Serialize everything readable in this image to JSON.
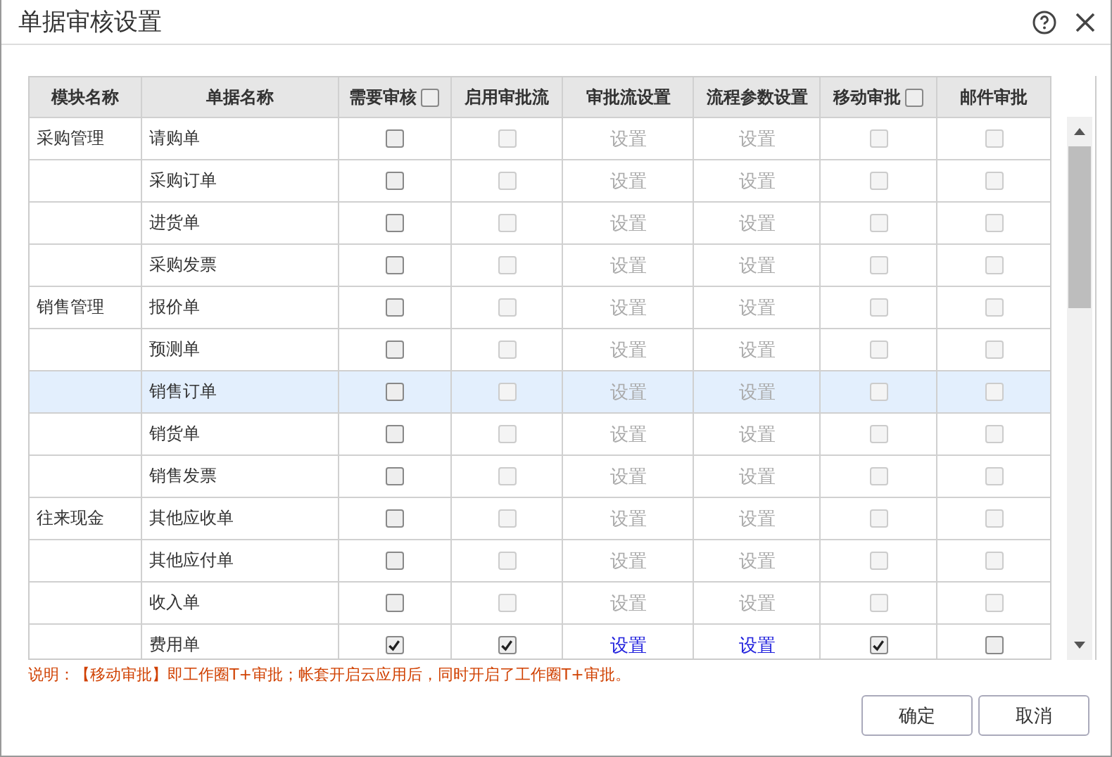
{
  "window": {
    "title": "单据审核设置"
  },
  "table": {
    "columns": [
      {
        "label": "模块名称"
      },
      {
        "label": "单据名称"
      },
      {
        "label": "需要审核",
        "checkbox": {
          "checked": false
        }
      },
      {
        "label": "启用审批流"
      },
      {
        "label": "审批流设置"
      },
      {
        "label": "流程参数设置"
      },
      {
        "label": "移动审批",
        "checkbox": {
          "checked": false
        }
      },
      {
        "label": "邮件审批"
      }
    ],
    "rows": [
      {
        "module": "采购管理",
        "name": "请购单",
        "selected": false,
        "require_review": {
          "checked": false,
          "disabled": false
        },
        "enable_flow": {
          "checked": false,
          "disabled": true
        },
        "flow_setting": {
          "label": "设置",
          "disabled": true
        },
        "param_setting": {
          "label": "设置",
          "disabled": true
        },
        "mobile": {
          "checked": false,
          "disabled": true
        },
        "mail": {
          "checked": false,
          "disabled": true
        }
      },
      {
        "name": "采购订单",
        "selected": false,
        "require_review": {
          "checked": false,
          "disabled": false
        },
        "enable_flow": {
          "checked": false,
          "disabled": true
        },
        "flow_setting": {
          "label": "设置",
          "disabled": true
        },
        "param_setting": {
          "label": "设置",
          "disabled": true
        },
        "mobile": {
          "checked": false,
          "disabled": true
        },
        "mail": {
          "checked": false,
          "disabled": true
        }
      },
      {
        "name": "进货单",
        "selected": false,
        "require_review": {
          "checked": false,
          "disabled": false
        },
        "enable_flow": {
          "checked": false,
          "disabled": true
        },
        "flow_setting": {
          "label": "设置",
          "disabled": true
        },
        "param_setting": {
          "label": "设置",
          "disabled": true
        },
        "mobile": {
          "checked": false,
          "disabled": true
        },
        "mail": {
          "checked": false,
          "disabled": true
        }
      },
      {
        "name": "采购发票",
        "selected": false,
        "require_review": {
          "checked": false,
          "disabled": false
        },
        "enable_flow": {
          "checked": false,
          "disabled": true
        },
        "flow_setting": {
          "label": "设置",
          "disabled": true
        },
        "param_setting": {
          "label": "设置",
          "disabled": true
        },
        "mobile": {
          "checked": false,
          "disabled": true
        },
        "mail": {
          "checked": false,
          "disabled": true
        }
      },
      {
        "module": "销售管理",
        "name": "报价单",
        "selected": false,
        "require_review": {
          "checked": false,
          "disabled": false
        },
        "enable_flow": {
          "checked": false,
          "disabled": true
        },
        "flow_setting": {
          "label": "设置",
          "disabled": true
        },
        "param_setting": {
          "label": "设置",
          "disabled": true
        },
        "mobile": {
          "checked": false,
          "disabled": true
        },
        "mail": {
          "checked": false,
          "disabled": true
        }
      },
      {
        "name": "预测单",
        "selected": false,
        "require_review": {
          "checked": false,
          "disabled": false
        },
        "enable_flow": {
          "checked": false,
          "disabled": true
        },
        "flow_setting": {
          "label": "设置",
          "disabled": true
        },
        "param_setting": {
          "label": "设置",
          "disabled": true
        },
        "mobile": {
          "checked": false,
          "disabled": true
        },
        "mail": {
          "checked": false,
          "disabled": true
        }
      },
      {
        "name": "销售订单",
        "selected": true,
        "require_review": {
          "checked": false,
          "disabled": false
        },
        "enable_flow": {
          "checked": false,
          "disabled": true
        },
        "flow_setting": {
          "label": "设置",
          "disabled": true
        },
        "param_setting": {
          "label": "设置",
          "disabled": true
        },
        "mobile": {
          "checked": false,
          "disabled": true
        },
        "mail": {
          "checked": false,
          "disabled": true
        }
      },
      {
        "name": "销货单",
        "selected": false,
        "require_review": {
          "checked": false,
          "disabled": false
        },
        "enable_flow": {
          "checked": false,
          "disabled": true
        },
        "flow_setting": {
          "label": "设置",
          "disabled": true
        },
        "param_setting": {
          "label": "设置",
          "disabled": true
        },
        "mobile": {
          "checked": false,
          "disabled": true
        },
        "mail": {
          "checked": false,
          "disabled": true
        }
      },
      {
        "name": "销售发票",
        "selected": false,
        "require_review": {
          "checked": false,
          "disabled": false
        },
        "enable_flow": {
          "checked": false,
          "disabled": true
        },
        "flow_setting": {
          "label": "设置",
          "disabled": true
        },
        "param_setting": {
          "label": "设置",
          "disabled": true
        },
        "mobile": {
          "checked": false,
          "disabled": true
        },
        "mail": {
          "checked": false,
          "disabled": true
        }
      },
      {
        "module": "往来现金",
        "name": "其他应收单",
        "selected": false,
        "require_review": {
          "checked": false,
          "disabled": false
        },
        "enable_flow": {
          "checked": false,
          "disabled": true
        },
        "flow_setting": {
          "label": "设置",
          "disabled": true
        },
        "param_setting": {
          "label": "设置",
          "disabled": true
        },
        "mobile": {
          "checked": false,
          "disabled": true
        },
        "mail": {
          "checked": false,
          "disabled": true
        }
      },
      {
        "name": "其他应付单",
        "selected": false,
        "require_review": {
          "checked": false,
          "disabled": false
        },
        "enable_flow": {
          "checked": false,
          "disabled": true
        },
        "flow_setting": {
          "label": "设置",
          "disabled": true
        },
        "param_setting": {
          "label": "设置",
          "disabled": true
        },
        "mobile": {
          "checked": false,
          "disabled": true
        },
        "mail": {
          "checked": false,
          "disabled": true
        }
      },
      {
        "name": "收入单",
        "selected": false,
        "require_review": {
          "checked": false,
          "disabled": false
        },
        "enable_flow": {
          "checked": false,
          "disabled": true
        },
        "flow_setting": {
          "label": "设置",
          "disabled": true
        },
        "param_setting": {
          "label": "设置",
          "disabled": true
        },
        "mobile": {
          "checked": false,
          "disabled": true
        },
        "mail": {
          "checked": false,
          "disabled": true
        }
      },
      {
        "name": "费用单",
        "selected": false,
        "require_review": {
          "checked": true,
          "disabled": false
        },
        "enable_flow": {
          "checked": true,
          "disabled": false
        },
        "flow_setting": {
          "label": "设置",
          "disabled": false
        },
        "param_setting": {
          "label": "设置",
          "disabled": false
        },
        "mobile": {
          "checked": true,
          "disabled": false
        },
        "mail": {
          "checked": false,
          "disabled": false
        }
      }
    ]
  },
  "note": "说明：【移动审批】即工作圈T+审批；帐套开启云应用后，同时开启了工作圈T+审批。",
  "buttons": [
    "确定",
    "取消"
  ]
}
